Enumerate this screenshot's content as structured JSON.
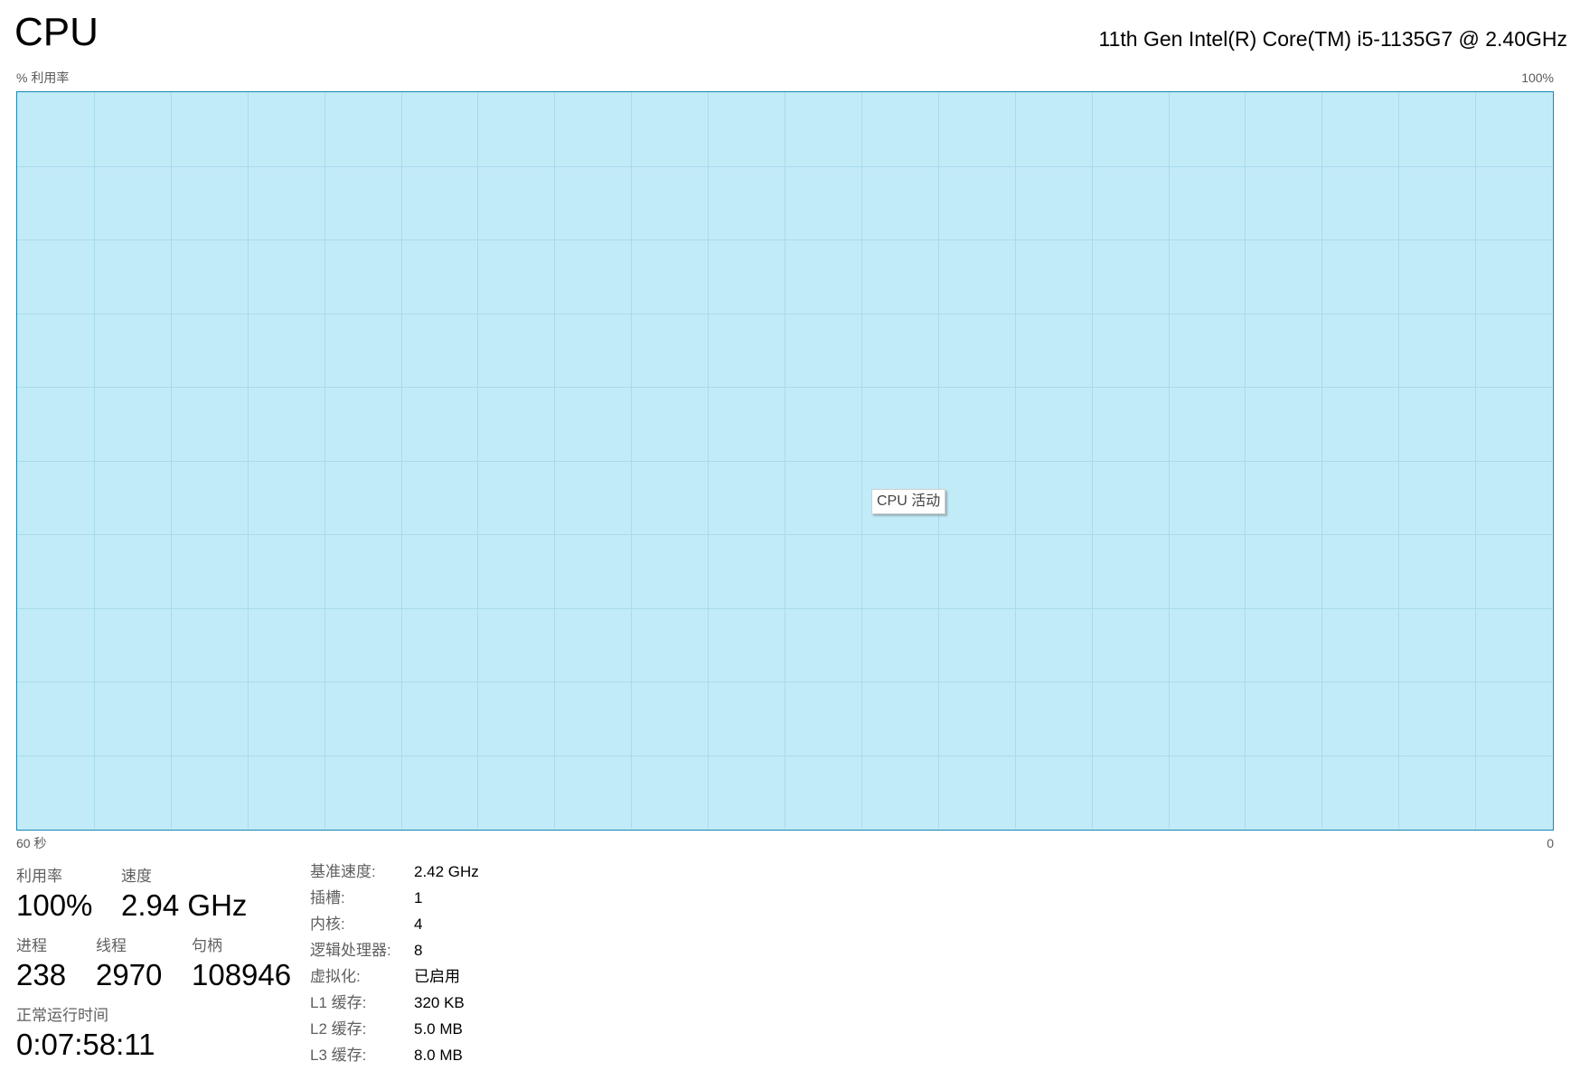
{
  "header": {
    "title": "CPU",
    "cpu_model": "11th Gen Intel(R) Core(TM) i5-1135G7 @ 2.40GHz"
  },
  "graph": {
    "y_label": "% 利用率",
    "y_max_label": "100%",
    "x_left_label": "60 秒",
    "x_right_label": "0",
    "tooltip": "CPU 活动",
    "utilization_fraction": 1.0,
    "colors": {
      "border": "#1788b1",
      "fill": "#c2ebf8",
      "grid": "#a9dbea"
    },
    "grid": {
      "columns": 20,
      "rows": 10
    }
  },
  "stats": {
    "utilization": {
      "label": "利用率",
      "value": "100%"
    },
    "speed": {
      "label": "速度",
      "value": "2.94 GHz"
    },
    "processes": {
      "label": "进程",
      "value": "238"
    },
    "threads": {
      "label": "线程",
      "value": "2970"
    },
    "handles": {
      "label": "句柄",
      "value": "108946"
    },
    "uptime": {
      "label": "正常运行时间",
      "value": "0:07:58:11"
    }
  },
  "info": [
    {
      "label": "基准速度:",
      "value": "2.42 GHz"
    },
    {
      "label": "插槽:",
      "value": "1"
    },
    {
      "label": "内核:",
      "value": "4"
    },
    {
      "label": "逻辑处理器:",
      "value": "8"
    },
    {
      "label": "虚拟化:",
      "value": "已启用"
    },
    {
      "label": "L1 缓存:",
      "value": "320 KB"
    },
    {
      "label": "L2 缓存:",
      "value": "5.0 MB"
    },
    {
      "label": "L3 缓存:",
      "value": "8.0 MB"
    }
  ]
}
